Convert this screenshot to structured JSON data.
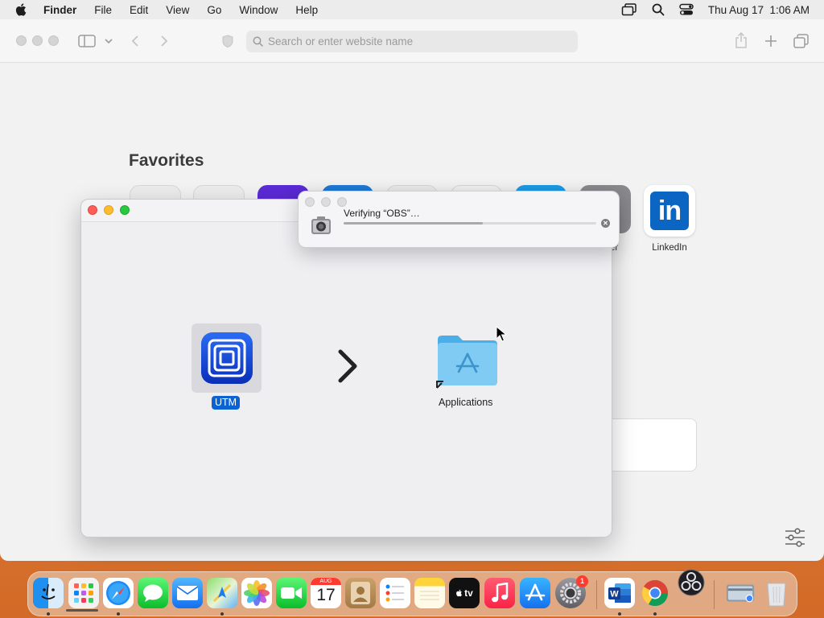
{
  "menubar": {
    "app_name": "Finder",
    "items": [
      "File",
      "Edit",
      "View",
      "Go",
      "Window",
      "Help"
    ],
    "clock": "Thu Aug 17  1:06 AM"
  },
  "safari": {
    "address_placeholder": "Search or enter website name",
    "favorites_title": "Favorites",
    "favorites_visible_labels": [
      "LinkedIn",
      "er"
    ]
  },
  "dmg": {
    "app_label": "UTM",
    "folder_label": "Applications"
  },
  "verify_dialog": {
    "message": "Verifying “OBS”…",
    "progress": 0.55
  },
  "dock": {
    "calendar_month": "AUG",
    "calendar_day": "17",
    "appletv_label": "tv",
    "settings_badge": "1"
  },
  "colors": {
    "accent": "#0a63d1",
    "linkedin": "#0a66c2",
    "close": "#ff5f57",
    "minimize": "#febc2e",
    "zoom": "#28c840"
  }
}
